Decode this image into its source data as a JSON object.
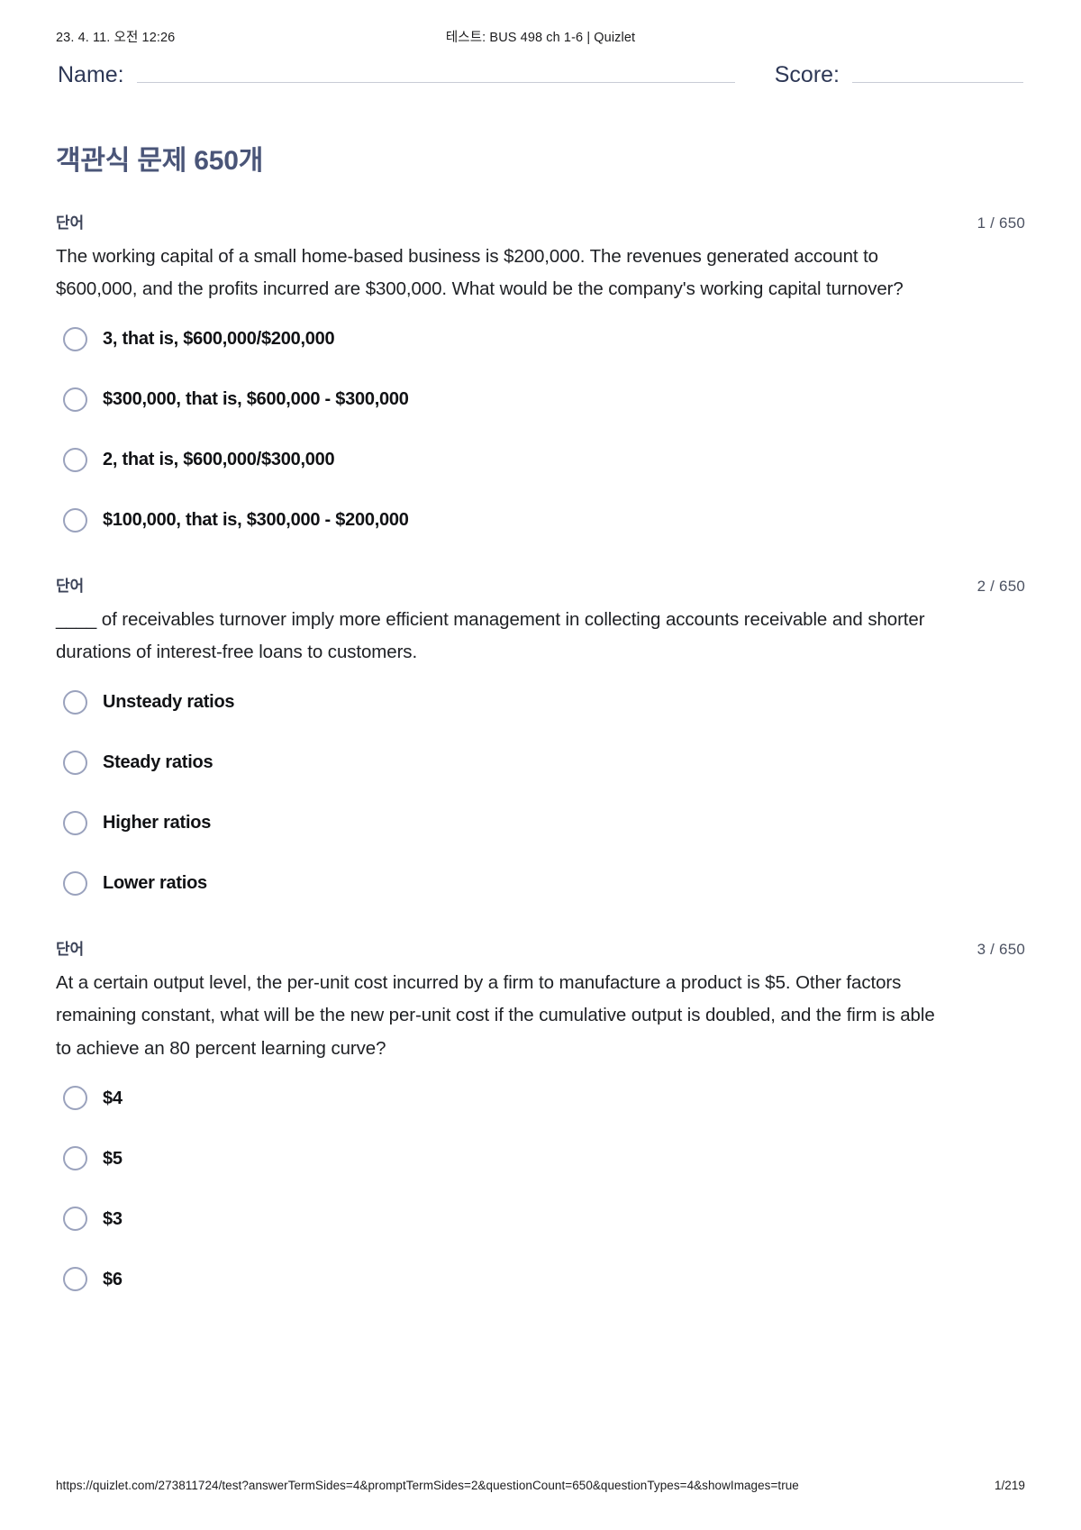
{
  "browser_print_header": {
    "datetime": "23. 4. 11. 오전 12:26",
    "document_title": "테스트: BUS 498 ch 1-6 | Quizlet"
  },
  "form_fields": {
    "name_label": "Name:",
    "score_label": "Score:"
  },
  "title": "객관식 문제 650개",
  "questions": [
    {
      "kind_label": "단어",
      "counter": "1 / 650",
      "prompt": "The working capital of a small home-based business is $200,000. The revenues generated account to $600,000, and the profits incurred are $300,000. What would be the company's working capital turnover?",
      "choices": [
        "3, that is, $600,000/$200,000",
        "$300,000, that is, $600,000 - $300,000",
        "2, that is, $600,000/$300,000",
        "$100,000, that is, $300,000 - $200,000"
      ]
    },
    {
      "kind_label": "단어",
      "counter": "2 / 650",
      "prompt": "____ of receivables turnover imply more efficient management in collecting accounts receivable and shorter durations of interest-free loans to customers.",
      "choices": [
        "Unsteady ratios",
        "Steady ratios",
        "Higher ratios",
        "Lower ratios"
      ]
    },
    {
      "kind_label": "단어",
      "counter": "3 / 650",
      "prompt": "At a certain output level, the per-unit cost incurred by a firm to manufacture a product is $5. Other factors remaining constant, what will be the new per-unit cost if the cumulative output is doubled, and the firm is able to achieve an 80 percent learning curve?",
      "choices": [
        "$4",
        "$5",
        "$3",
        "$6"
      ]
    }
  ],
  "browser_print_footer": {
    "url": "https://quizlet.com/273811724/test?answerTermSides=4&promptTermSides=2&questionCount=650&questionTypes=4&showImages=true",
    "page": "1/219"
  },
  "colors": {
    "title": "#4a5578",
    "radio_border": "#9aa2bd",
    "rule": "#c9ccd6"
  }
}
